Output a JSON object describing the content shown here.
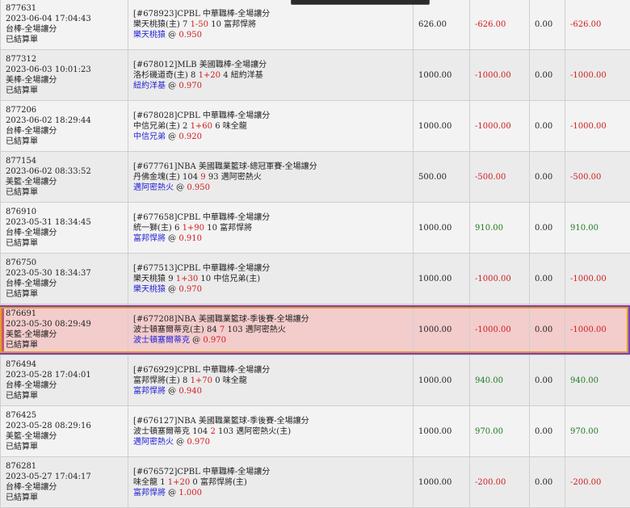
{
  "rows": [
    {
      "id": "877631",
      "time": "2023-06-04 17:04:43",
      "category": "台棒-全場讓分",
      "status": "已結算單",
      "match_id": "[#678923]",
      "league": "CPBL 中華職棒-全場讓分",
      "home": "樂天桃猿(主)",
      "home_score": "7",
      "handicap": "1-50",
      "away_score": "10",
      "away": "富邦悍將",
      "pick": "樂天桃猿",
      "odds": "0.950",
      "stake": "626.00",
      "result": "-626.00",
      "commission": "0.00",
      "net": "-626.00",
      "highlight": false
    },
    {
      "id": "877312",
      "time": "2023-06-03 10:01:23",
      "category": "美棒-全場讓分",
      "status": "已結算單",
      "match_id": "[#678012]",
      "league": "MLB 美國職棒-全場讓分",
      "home": "洛杉磯道奇(主)",
      "home_score": "8",
      "handicap": "1+20",
      "away_score": "4",
      "away": "紐約洋基",
      "pick": "紐約洋基",
      "odds": "0.970",
      "stake": "1000.00",
      "result": "-1000.00",
      "commission": "0.00",
      "net": "-1000.00",
      "highlight": false
    },
    {
      "id": "877206",
      "time": "2023-06-02 18:29:44",
      "category": "台棒-全場讓分",
      "status": "已結算單",
      "match_id": "[#678028]",
      "league": "CPBL 中華職棒-全場讓分",
      "home": "中信兄弟(主)",
      "home_score": "2",
      "handicap": "1+60",
      "away_score": "6",
      "away": "味全龍",
      "pick": "中信兄弟",
      "odds": "0.920",
      "stake": "1000.00",
      "result": "-1000.00",
      "commission": "0.00",
      "net": "-1000.00",
      "highlight": false
    },
    {
      "id": "877154",
      "time": "2023-06-02 08:33:52",
      "category": "美籃-全場讓分",
      "status": "已結算單",
      "match_id": "[#677761]",
      "league": "NBA 美國職業籃球-總冠軍賽-全場讓分",
      "home": "丹佛金塊(主)",
      "home_score": "104",
      "handicap": "9",
      "away_score": "93",
      "away": "邁阿密熱火",
      "pick": "邁阿密熱火",
      "odds": "0.950",
      "stake": "500.00",
      "result": "-500.00",
      "commission": "0.00",
      "net": "-500.00",
      "highlight": false
    },
    {
      "id": "876910",
      "time": "2023-05-31 18:34:45",
      "category": "台棒-全場讓分",
      "status": "已結算單",
      "match_id": "[#677658]",
      "league": "CPBL 中華職棒-全場讓分",
      "home": "統一獅(主)",
      "home_score": "6",
      "handicap": "1+90",
      "away_score": "10",
      "away": "富邦悍將",
      "pick": "富邦悍將",
      "odds": "0.910",
      "stake": "1000.00",
      "result": "910.00",
      "commission": "0.00",
      "net": "910.00",
      "highlight": false
    },
    {
      "id": "876750",
      "time": "2023-05-30 18:34:37",
      "category": "台棒-全場讓分",
      "status": "已結算單",
      "match_id": "[#677513]",
      "league": "CPBL 中華職棒-全場讓分",
      "home": "樂天桃猿",
      "home_score": "9",
      "handicap": "1+30",
      "away_score": "10",
      "away": "中信兄弟(主)",
      "pick": "樂天桃猿",
      "odds": "0.970",
      "stake": "1000.00",
      "result": "-1000.00",
      "commission": "0.00",
      "net": "-1000.00",
      "highlight": false
    },
    {
      "id": "876691",
      "time": "2023-05-30 08:29:49",
      "category": "美籃-全場讓分",
      "status": "已結算單",
      "match_id": "[#677208]",
      "league": "NBA 美國職業籃球-季後賽-全場讓分",
      "home": "波士頓塞爾蒂克(主)",
      "home_score": "84",
      "handicap": "7",
      "away_score": "103",
      "away": "邁阿密熱火",
      "pick": "波士頓塞爾蒂克",
      "odds": "0.970",
      "stake": "1000.00",
      "result": "-1000.00",
      "commission": "0.00",
      "net": "-1000.00",
      "highlight": true
    },
    {
      "id": "876494",
      "time": "2023-05-28 17:04:01",
      "category": "台棒-全場讓分",
      "status": "已結算單",
      "match_id": "[#676929]",
      "league": "CPBL 中華職棒-全場讓分",
      "home": "富邦悍將(主)",
      "home_score": "8",
      "handicap": "1+70",
      "away_score": "0",
      "away": "味全龍",
      "pick": "富邦悍將",
      "odds": "0.940",
      "stake": "1000.00",
      "result": "940.00",
      "commission": "0.00",
      "net": "940.00",
      "highlight": false
    },
    {
      "id": "876425",
      "time": "2023-05-28 08:29:16",
      "category": "美籃-全場讓分",
      "status": "已結算單",
      "match_id": "[#676127]",
      "league": "NBA 美國職業籃球-季後賽-全場讓分",
      "home": "波士頓塞爾蒂克",
      "home_score": "104",
      "handicap": "2",
      "away_score": "103",
      "away": "邁阿密熱火(主)",
      "pick": "邁阿密熱火",
      "odds": "0.970",
      "stake": "1000.00",
      "result": "970.00",
      "commission": "0.00",
      "net": "970.00",
      "highlight": false
    },
    {
      "id": "876281",
      "time": "2023-05-27 17:04:17",
      "category": "台棒-全場讓分",
      "status": "已結算單",
      "match_id": "[#676572]",
      "league": "CPBL 中華職棒-全場讓分",
      "home": "味全龍",
      "home_score": "1",
      "handicap": "1+20",
      "away_score": "0",
      "away": "富邦悍將(主)",
      "pick": "富邦悍將",
      "odds": "1.000",
      "stake": "1000.00",
      "result": "-200.00",
      "commission": "0.00",
      "net": "-200.00",
      "highlight": false
    }
  ]
}
